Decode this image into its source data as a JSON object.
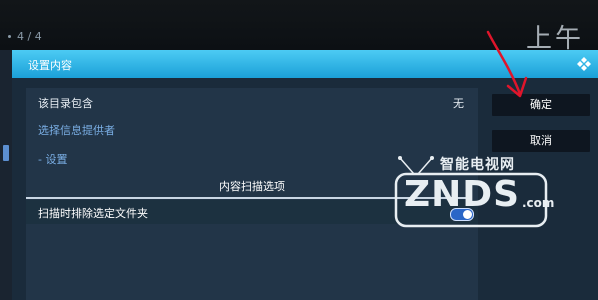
{
  "status": {
    "page_indicator": "4 / 4",
    "clock": "上午"
  },
  "dialog": {
    "title": "设置内容",
    "kodi_icon": "kodi-logo-icon"
  },
  "list": {
    "contains_label": "该目录包含",
    "contains_value": "无",
    "provider_label": "选择信息提供者",
    "settings_label": "- 设置",
    "section_header": "内容扫描选项",
    "exclude_label": "扫描时排除选定文件夹",
    "exclude_toggle_on": true
  },
  "buttons": {
    "ok": "确定",
    "cancel": "取消"
  },
  "watermark": {
    "top": "智能电视网",
    "main": "ZNDS",
    "dotcom": ".com"
  },
  "colors": {
    "header_accent": "#1ba0d8",
    "link_text": "#7aaee4",
    "toggle_on": "#2a66c7",
    "annotation_arrow": "#e0152b"
  }
}
